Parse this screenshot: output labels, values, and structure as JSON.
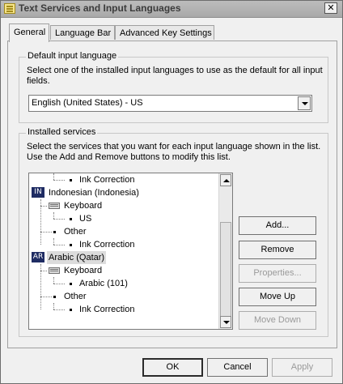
{
  "window": {
    "title": "Text Services and Input Languages",
    "close_label": "✕"
  },
  "tabs": [
    {
      "label": "General",
      "active": true
    },
    {
      "label": "Language Bar",
      "active": false
    },
    {
      "label": "Advanced Key Settings",
      "active": false
    }
  ],
  "default_input_language": {
    "group_label": "Default input language",
    "description_line1": "Select one of the installed input languages to use as the default for all input",
    "description_line2": "fields.",
    "selected": "English (United States) - US"
  },
  "installed_services": {
    "group_label": "Installed services",
    "description_line1": "Select the services that you want for each input language shown in the list.",
    "description_line2": "Use the Add and Remove buttons to modify this list.",
    "tree": [
      {
        "type": "service",
        "label": "Ink Correction"
      },
      {
        "type": "language",
        "badge": "IN",
        "label": "Indonesian (Indonesia)"
      },
      {
        "type": "category",
        "label": "Keyboard",
        "icon": "keyboard-icon"
      },
      {
        "type": "service",
        "label": "US"
      },
      {
        "type": "category",
        "label": "Other"
      },
      {
        "type": "service",
        "label": "Ink Correction"
      },
      {
        "type": "language",
        "badge": "AR",
        "label": "Arabic (Qatar)",
        "selected": true
      },
      {
        "type": "category",
        "label": "Keyboard",
        "icon": "keyboard-icon"
      },
      {
        "type": "service",
        "label": "Arabic (101)"
      },
      {
        "type": "category",
        "label": "Other"
      },
      {
        "type": "service",
        "label": "Ink Correction"
      }
    ],
    "buttons": {
      "add": "Add...",
      "remove": "Remove",
      "properties": "Properties...",
      "move_up": "Move Up",
      "move_down": "Move Down"
    }
  },
  "footer": {
    "ok": "OK",
    "cancel": "Cancel",
    "apply": "Apply"
  },
  "colors": {
    "language_badge_bg": "#1f2c63",
    "selection_bg": "#dcdcdc",
    "disabled_text": "#9a9a9a"
  }
}
